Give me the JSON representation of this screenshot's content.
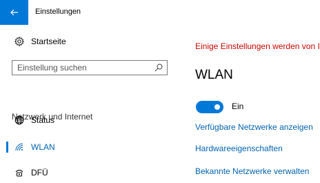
{
  "window": {
    "title": "Einstellungen"
  },
  "sidebar": {
    "home_label": "Startseite",
    "search_placeholder": "Einstellung suchen",
    "section_label": "Netzwerk und Internet",
    "items": [
      {
        "label": "Status",
        "icon": "globe-icon"
      },
      {
        "label": "WLAN",
        "icon": "wifi-icon",
        "active": true
      },
      {
        "label": "DFÜ",
        "icon": "dialup-icon"
      }
    ]
  },
  "main": {
    "warning": "Einige Einstellungen werden von Ih",
    "title": "WLAN",
    "toggle": {
      "state": "Ein",
      "on": true
    },
    "links": [
      "Verfügbare Netzwerke anzeigen",
      "Hardwareeigenschaften",
      "Bekannte Netzwerke verwalten"
    ]
  },
  "colors": {
    "accent": "#0078d7",
    "link": "#0063b1",
    "warning": "#c50500"
  }
}
